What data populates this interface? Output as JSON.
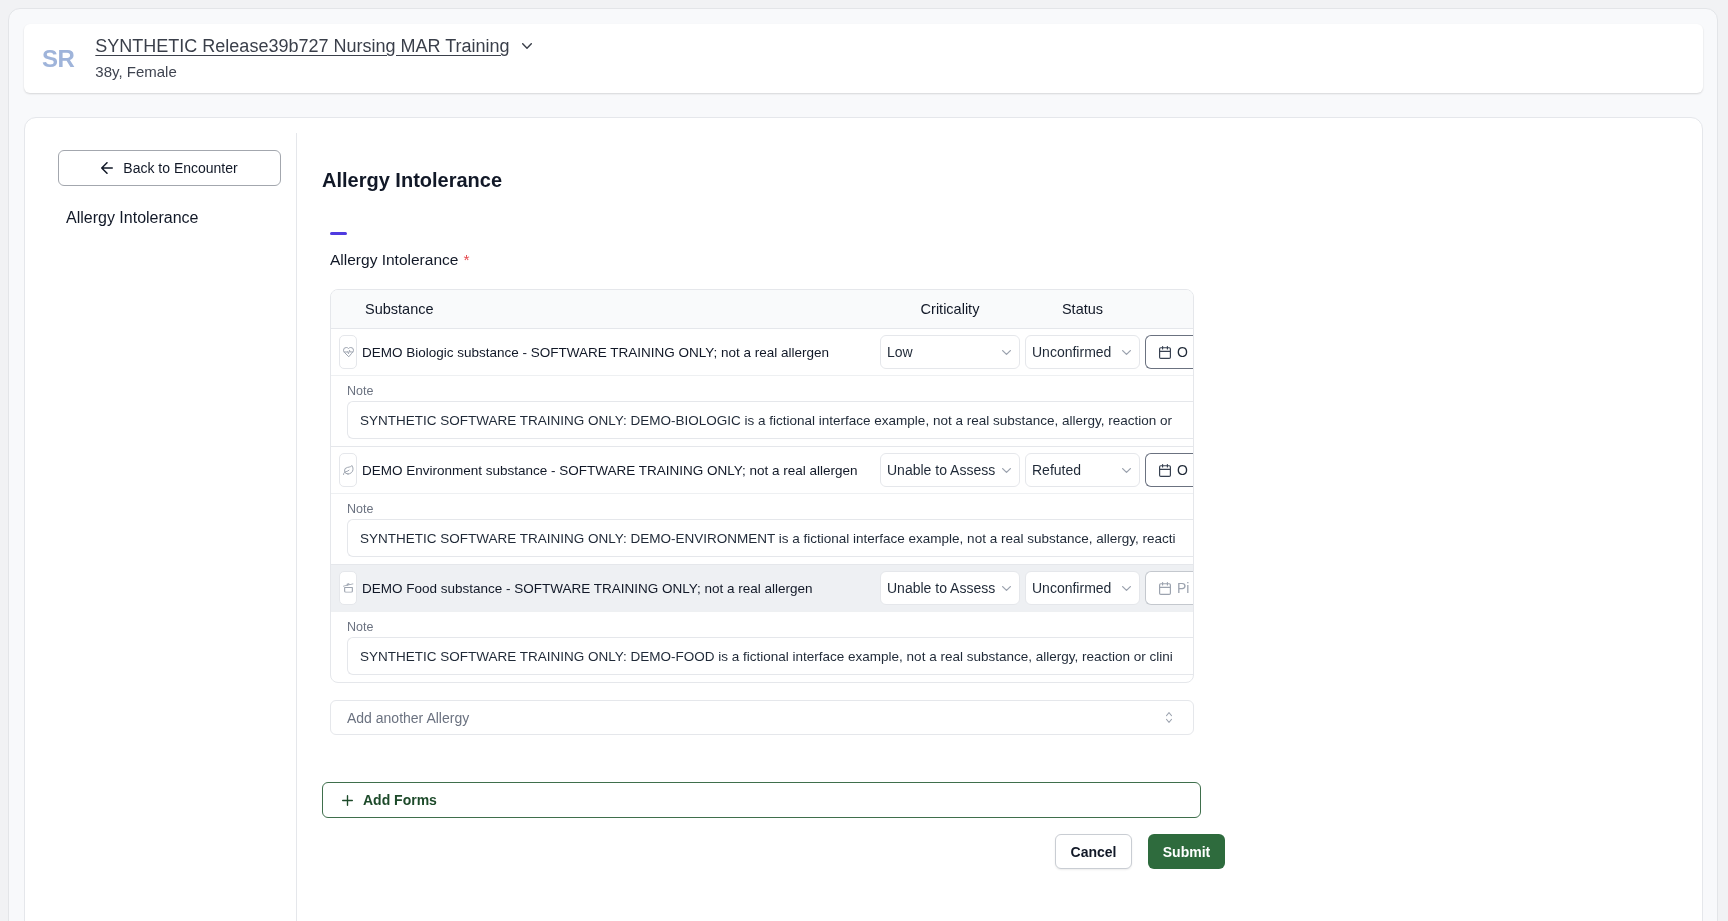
{
  "header": {
    "avatar_initials": "SR",
    "patient_name": "SYNTHETIC Release39b727 Nursing MAR Training",
    "patient_details": "38y, Female"
  },
  "sidebar": {
    "back_button": "Back to Encounter",
    "items": [
      {
        "label": "Allergy Intolerance"
      }
    ]
  },
  "form": {
    "title": "Allergy Intolerance",
    "question": {
      "label": "Allergy Intolerance",
      "required_mark": "*"
    },
    "table": {
      "columns": [
        "Substance",
        "Criticality",
        "Status"
      ],
      "rows": [
        {
          "kind": "biologic",
          "substance": "DEMO Biologic substance - SOFTWARE TRAINING ONLY; not a real allergen",
          "criticality": "Low",
          "status": "Unconfirmed",
          "date": {
            "value": "O"
          },
          "note_label": "Note",
          "note": "SYNTHETIC SOFTWARE TRAINING ONLY: DEMO-BIOLOGIC is a fictional interface example, not a real substance, allergy, reaction or",
          "highlighted": false
        },
        {
          "kind": "environment",
          "substance": "DEMO Environment substance - SOFTWARE TRAINING ONLY; not a real allergen",
          "criticality": "Unable to Assess",
          "status": "Refuted",
          "date": {
            "value": "O"
          },
          "note_label": "Note",
          "note": "SYNTHETIC SOFTWARE TRAINING ONLY: DEMO-ENVIRONMENT is a fictional interface example, not a real substance, allergy, reacti",
          "highlighted": false
        },
        {
          "kind": "food",
          "substance": "DEMO Food substance - SOFTWARE TRAINING ONLY; not a real allergen",
          "criticality": "Unable to Assess",
          "status": "Unconfirmed",
          "date": {
            "placeholder": "Pi"
          },
          "note_label": "Note",
          "note": "SYNTHETIC SOFTWARE TRAINING ONLY: DEMO-FOOD is a fictional interface example, not a real substance, allergy, reaction or clini",
          "highlighted": true
        }
      ]
    },
    "add_allergy": {
      "placeholder": "Add another Allergy"
    },
    "add_forms_button": "Add Forms"
  },
  "actions": {
    "cancel": "Cancel",
    "submit": "Submit"
  }
}
